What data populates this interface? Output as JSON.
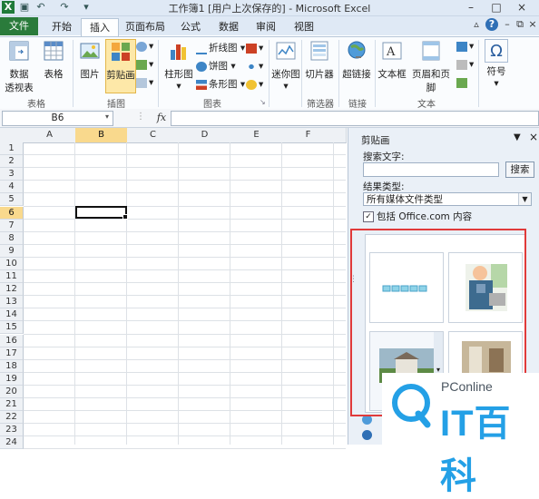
{
  "window": {
    "title": "工作簿1 [用户上次保存的] - Microsoft Excel",
    "controls": {
      "help": "?",
      "minimize": "–",
      "maximize": "□",
      "close": "×"
    }
  },
  "ribbon": {
    "tabs": [
      "文件",
      "开始",
      "插入",
      "页面布局",
      "公式",
      "数据",
      "审阅",
      "视图"
    ],
    "active_tab": "插入",
    "groups": {
      "tables": {
        "label": "表格",
        "pivot_line1": "数据",
        "pivot_line2": "透视表",
        "table": "表格"
      },
      "illustrations": {
        "label": "插图",
        "picture": "图片",
        "clipart": "剪贴画"
      },
      "charts": {
        "label": "图表",
        "column": "柱形图",
        "line": "折线图",
        "pie": "饼图",
        "bar": "条形图"
      },
      "sparklines": {
        "label": "迷你图",
        "button": "迷你图"
      },
      "filter": {
        "label": "筛选器",
        "slicer": "切片器"
      },
      "links": {
        "label": "链接",
        "hyperlink": "超链接"
      },
      "text": {
        "label": "文本",
        "textbox": "文本框",
        "header_footer": "页眉和页脚"
      },
      "symbols": {
        "symbol": "符号"
      }
    }
  },
  "formula_bar": {
    "name_box": "B6",
    "fx": "fx",
    "value": ""
  },
  "sheet": {
    "columns": [
      "A",
      "B",
      "C",
      "D",
      "E",
      "F"
    ],
    "selected_column": "B",
    "rows": [
      "1",
      "2",
      "3",
      "4",
      "5",
      "6",
      "7",
      "8",
      "9",
      "10",
      "11",
      "12",
      "13",
      "14",
      "15",
      "16",
      "17",
      "18",
      "19",
      "20",
      "21",
      "22",
      "23",
      "24"
    ],
    "selected_row": "6"
  },
  "clipart_pane": {
    "title": "剪贴画",
    "search_label": "搜索文字:",
    "search_value": "",
    "search_button": "搜索",
    "type_label": "结果类型:",
    "type_value": "所有媒体文件类型",
    "include_label": "包括 Office.com 内容",
    "include_checked": true
  },
  "watermark": {
    "brand": "PConline",
    "big": "IT百科"
  },
  "colors": {
    "file_tab": "#2a7b3b",
    "selection": "#f9d98d",
    "highlight_box": "#e03a3a",
    "watermark_blue": "#24a0e6"
  }
}
